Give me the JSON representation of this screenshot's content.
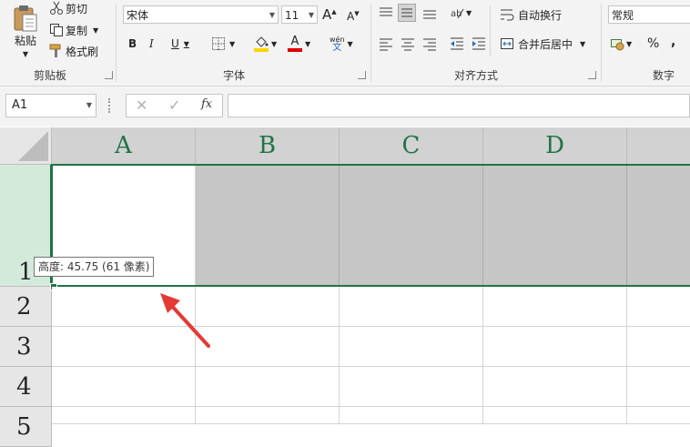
{
  "clipboard": {
    "paste_label": "粘贴",
    "cut_label": "剪切",
    "copy_label": "复制",
    "format_painter_label": "格式刷",
    "group_label": "剪贴板"
  },
  "font": {
    "font_name": "宋体",
    "font_size": "11",
    "bold": "B",
    "italic": "I",
    "underline": "U",
    "phonetic": "wén",
    "group_label": "字体",
    "font_color": "#e00000",
    "fill_color": "#ffd400"
  },
  "alignment": {
    "wrap_text_label": "自动换行",
    "merge_center_label": "合并后居中",
    "group_label": "对齐方式"
  },
  "number": {
    "format_value": "常规",
    "percent": "%",
    "comma": ",",
    "group_label": "数字"
  },
  "formula_bar": {
    "name_box": "A1",
    "fx": "fx",
    "formula_value": ""
  },
  "sheet": {
    "columns": [
      "A",
      "B",
      "C",
      "D"
    ],
    "rows": [
      "1",
      "2",
      "3",
      "4",
      "5"
    ],
    "accent_color": "#217346",
    "tooltip": "高度: 45.75 (61 像素)"
  }
}
